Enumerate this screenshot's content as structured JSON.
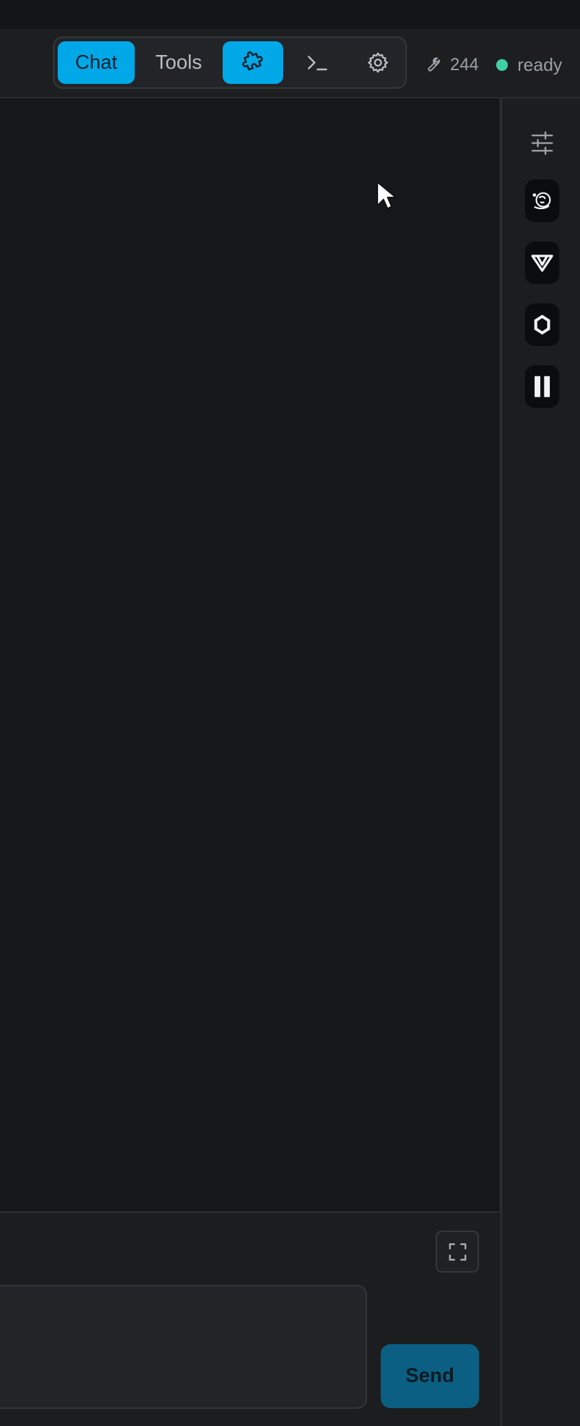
{
  "header": {
    "tabs": [
      {
        "label": "Chat",
        "active": true
      },
      {
        "label": "Tools",
        "active": false
      }
    ],
    "icon_buttons": [
      {
        "icon": "puzzle-icon",
        "active": true
      },
      {
        "icon": "terminal-icon",
        "active": false
      },
      {
        "icon": "gear-icon",
        "active": false
      }
    ],
    "tool_count": "244",
    "status": "ready"
  },
  "sidebar": {
    "icons": [
      "sliders-icon",
      "extension-logo-icon",
      "v-logo-icon",
      "ring-logo-icon",
      "pause-logo-icon"
    ]
  },
  "composer": {
    "input_value": "",
    "send_label": "Send"
  },
  "colors": {
    "accent": "#00a8e8",
    "status_ready": "#3fd1a5",
    "send_button": "#0b5f82"
  }
}
